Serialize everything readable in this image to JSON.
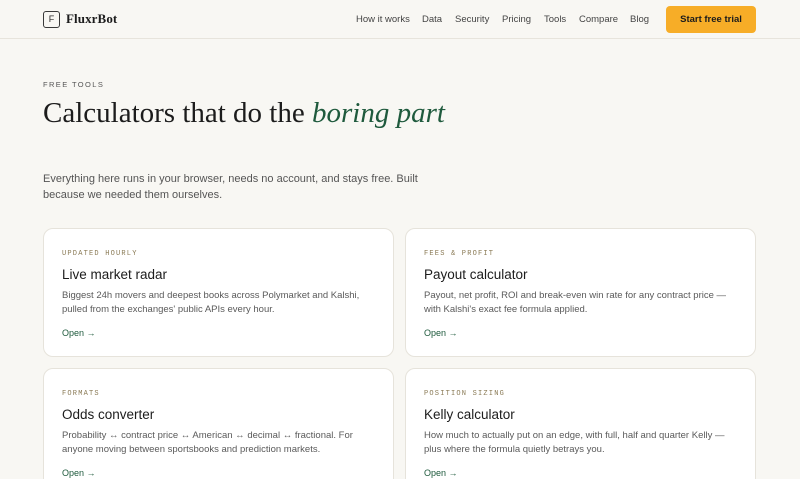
{
  "brand": {
    "logo_letter": "F",
    "name": "FluxrBot"
  },
  "nav": {
    "links": [
      "How it works",
      "Data",
      "Security",
      "Pricing",
      "Tools",
      "Compare",
      "Blog"
    ],
    "cta_label": "Start free trial"
  },
  "hero": {
    "eyebrow": "FREE TOOLS",
    "headline_plain": "Calculators that do the ",
    "headline_accent": "boring part",
    "lede": "Everything here runs in your browser, needs no account, and stays free. Built because we needed them ourselves."
  },
  "cards": [
    {
      "eyebrow": "UPDATED HOURLY",
      "title": "Live market radar",
      "description": "Biggest 24h movers and deepest books across Polymarket and Kalshi, pulled from the exchanges' public APIs every hour.",
      "link": "Open →"
    },
    {
      "eyebrow": "FEES & PROFIT",
      "title": "Payout calculator",
      "description": "Payout, net profit, ROI and break-even win rate for any contract price — with Kalshi's exact fee formula applied.",
      "link": "Open →"
    },
    {
      "eyebrow": "FORMATS",
      "title": "Odds converter",
      "description": "Probability ↔ contract price ↔ American ↔ decimal ↔ fractional. For anyone moving between sportsbooks and prediction markets.",
      "link": "Open →"
    },
    {
      "eyebrow": "POSITION SIZING",
      "title": "Kelly calculator",
      "description": "How much to actually put on an edge, with full, half and quarter Kelly — plus where the formula quietly betrays you.",
      "link": "Open →"
    }
  ],
  "colors": {
    "background": "#f8f7f3",
    "accent_green": "#1f5a3d",
    "cta_orange": "#f7ad27",
    "card_border": "#e6e3db"
  }
}
